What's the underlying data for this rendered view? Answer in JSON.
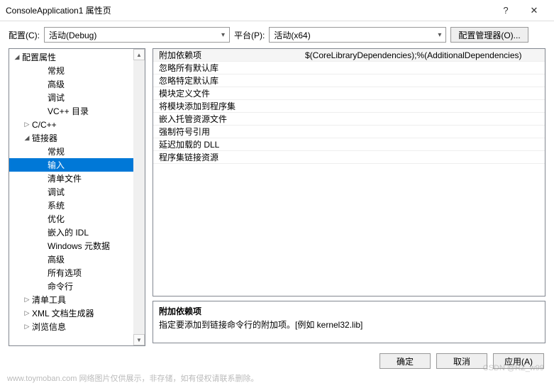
{
  "dialog": {
    "title": "ConsoleApplication1 属性页",
    "help": "?",
    "close": "✕"
  },
  "toolbar": {
    "config_label": "配置(C):",
    "config_value": "活动(Debug)",
    "platform_label": "平台(P):",
    "platform_value": "活动(x64)",
    "manager_btn": "配置管理器(O)..."
  },
  "tree": [
    {
      "indent": 0,
      "toggle": "◢",
      "label": "配置属性"
    },
    {
      "indent": 2,
      "toggle": "",
      "label": "常规"
    },
    {
      "indent": 2,
      "toggle": "",
      "label": "高级"
    },
    {
      "indent": 2,
      "toggle": "",
      "label": "调试"
    },
    {
      "indent": 2,
      "toggle": "",
      "label": "VC++ 目录"
    },
    {
      "indent": 1,
      "toggle": "▷",
      "label": "C/C++"
    },
    {
      "indent": 1,
      "toggle": "◢",
      "label": "链接器"
    },
    {
      "indent": 2,
      "toggle": "",
      "label": "常规"
    },
    {
      "indent": 2,
      "toggle": "",
      "label": "输入",
      "selected": true
    },
    {
      "indent": 2,
      "toggle": "",
      "label": "清单文件"
    },
    {
      "indent": 2,
      "toggle": "",
      "label": "调试"
    },
    {
      "indent": 2,
      "toggle": "",
      "label": "系统"
    },
    {
      "indent": 2,
      "toggle": "",
      "label": "优化"
    },
    {
      "indent": 2,
      "toggle": "",
      "label": "嵌入的 IDL"
    },
    {
      "indent": 2,
      "toggle": "",
      "label": "Windows 元数据"
    },
    {
      "indent": 2,
      "toggle": "",
      "label": "高级"
    },
    {
      "indent": 2,
      "toggle": "",
      "label": "所有选项"
    },
    {
      "indent": 2,
      "toggle": "",
      "label": "命令行"
    },
    {
      "indent": 1,
      "toggle": "▷",
      "label": "清单工具"
    },
    {
      "indent": 1,
      "toggle": "▷",
      "label": "XML 文档生成器"
    },
    {
      "indent": 1,
      "toggle": "▷",
      "label": "浏览信息"
    }
  ],
  "grid": [
    {
      "label": "附加依赖项",
      "value": "$(CoreLibraryDependencies);%(AdditionalDependencies)"
    },
    {
      "label": "忽略所有默认库",
      "value": ""
    },
    {
      "label": "忽略特定默认库",
      "value": ""
    },
    {
      "label": "模块定义文件",
      "value": ""
    },
    {
      "label": "将模块添加到程序集",
      "value": ""
    },
    {
      "label": "嵌入托管资源文件",
      "value": ""
    },
    {
      "label": "强制符号引用",
      "value": ""
    },
    {
      "label": "延迟加载的 DLL",
      "value": ""
    },
    {
      "label": "程序集链接资源",
      "value": ""
    }
  ],
  "description": {
    "title": "附加依赖项",
    "text": "指定要添加到链接命令行的附加项。[例如 kernel32.lib]"
  },
  "footer": {
    "ok": "确定",
    "cancel": "取消",
    "apply": "应用(A)"
  },
  "watermark": "www.toymoban.com  网络图片仅供展示，非存储，如有侵权请联系删除。",
  "csdn": "CSDN @RZ_w99"
}
